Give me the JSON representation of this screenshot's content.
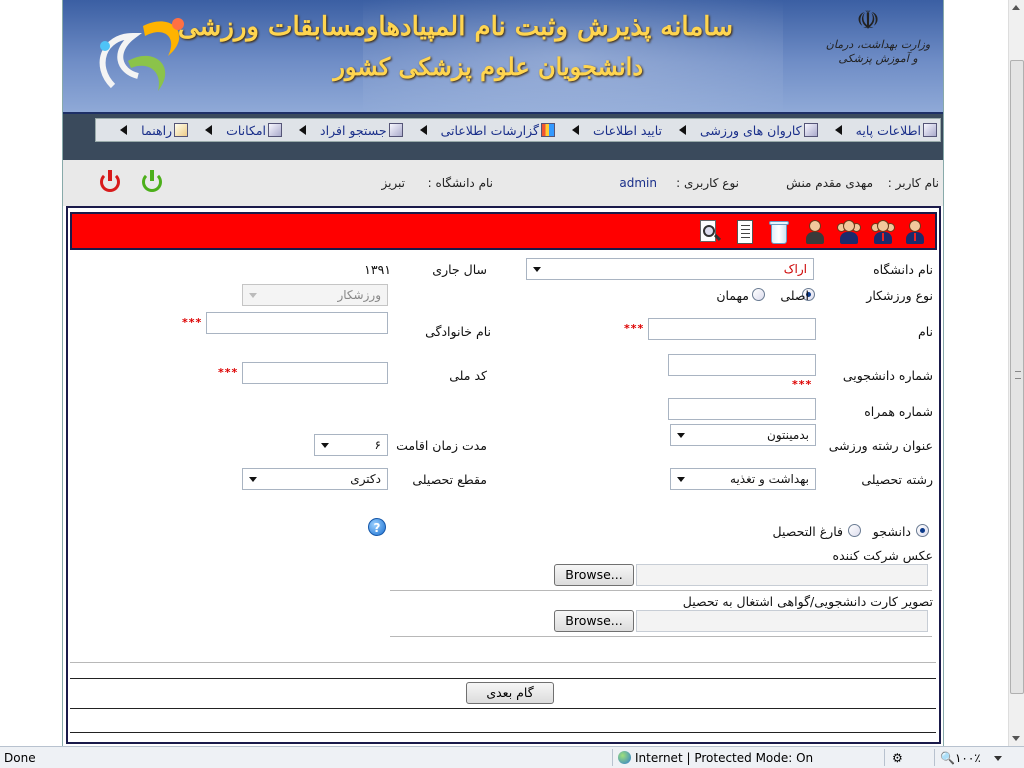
{
  "banner": {
    "title_line1": "سامانه پذیرش وثبت نام المپیادهاومسابقات ورزشی",
    "title_line2": "دانشجویان علوم پزشکی کشور",
    "ministry_text": "وزارت بهداشت، درمان و آموزش پزشکی",
    "emblem_icon": "iran-emblem-icon",
    "logo_icon": "olympiad-logo-icon"
  },
  "menu": {
    "items": [
      {
        "label": "اطلاعات پایه",
        "icon": "table-icon"
      },
      {
        "label": "کاروان های ورزشی",
        "icon": "group-icon"
      },
      {
        "label": "تایید اطلاعات",
        "icon": ""
      },
      {
        "label": "گزارشات اطلاعاتی",
        "icon": "bar-chart-icon"
      },
      {
        "label": "جستجو افراد",
        "icon": "search-window-icon"
      },
      {
        "label": "امکانات",
        "icon": "tools-icon"
      },
      {
        "label": "راهنما",
        "icon": "help-icon"
      }
    ]
  },
  "user": {
    "username_label": "نام کاربر :",
    "username_value": "مهدی مقدم منش",
    "usertype_label": "نوع کاربری :",
    "usertype_value": "admin",
    "university_label": "نام دانشگاه :",
    "university_value": "تبریز",
    "power_colors": {
      "green": "#4caf1a",
      "red": "#d81b1b"
    }
  },
  "toolbar": {
    "bg_color": "#ff0000",
    "icons": [
      "single-person-icon",
      "people-group-icon",
      "people-group-icon",
      "single-person-icon",
      "recycle-bin-icon",
      "document-list-icon",
      "magnifier-document-icon"
    ]
  },
  "form": {
    "university_label": "نام دانشگاه",
    "university_value": "اراک",
    "current_year_label": "سال جاری",
    "current_year_value": "۱۳۹۱",
    "athlete_type_label": "نوع ورزشکار",
    "athlete_type_options": [
      "اصلی",
      "مهمان"
    ],
    "athlete_type_selected": "اصلی",
    "athlete_role_value": "ورزشکار",
    "name_label": "نام",
    "family_label": "نام خانوادگی",
    "student_no_label": "شماره دانشجویی",
    "national_code_label": "کد ملی",
    "mobile_label": "شماره همراه",
    "sport_label": "عنوان رشته ورزشی",
    "sport_value": "بدمینتون",
    "stay_label": "مدت زمان اقامت",
    "stay_value": "۶",
    "field_label": "رشته تحصیلی",
    "field_value": "بهداشت و تغذیه",
    "grade_label": "مقطع تحصیلی",
    "grade_value": "دکتری",
    "status_options": [
      "دانشجو",
      "فارغ التحصیل"
    ],
    "status_selected": "دانشجو",
    "photo_label": "عکس شرکت کننده",
    "card_label": "تصویر کارت دانشجویی/گواهی اشتغال به تحصیل",
    "browse_label": "Browse...",
    "required_mark": "***",
    "next_button": "گام بعدی",
    "help_icon": "help-question-icon"
  },
  "statusbar": {
    "status_text": "Done",
    "zone_text": "Internet | Protected Mode: On",
    "zoom_text": "۱۰۰٪"
  }
}
